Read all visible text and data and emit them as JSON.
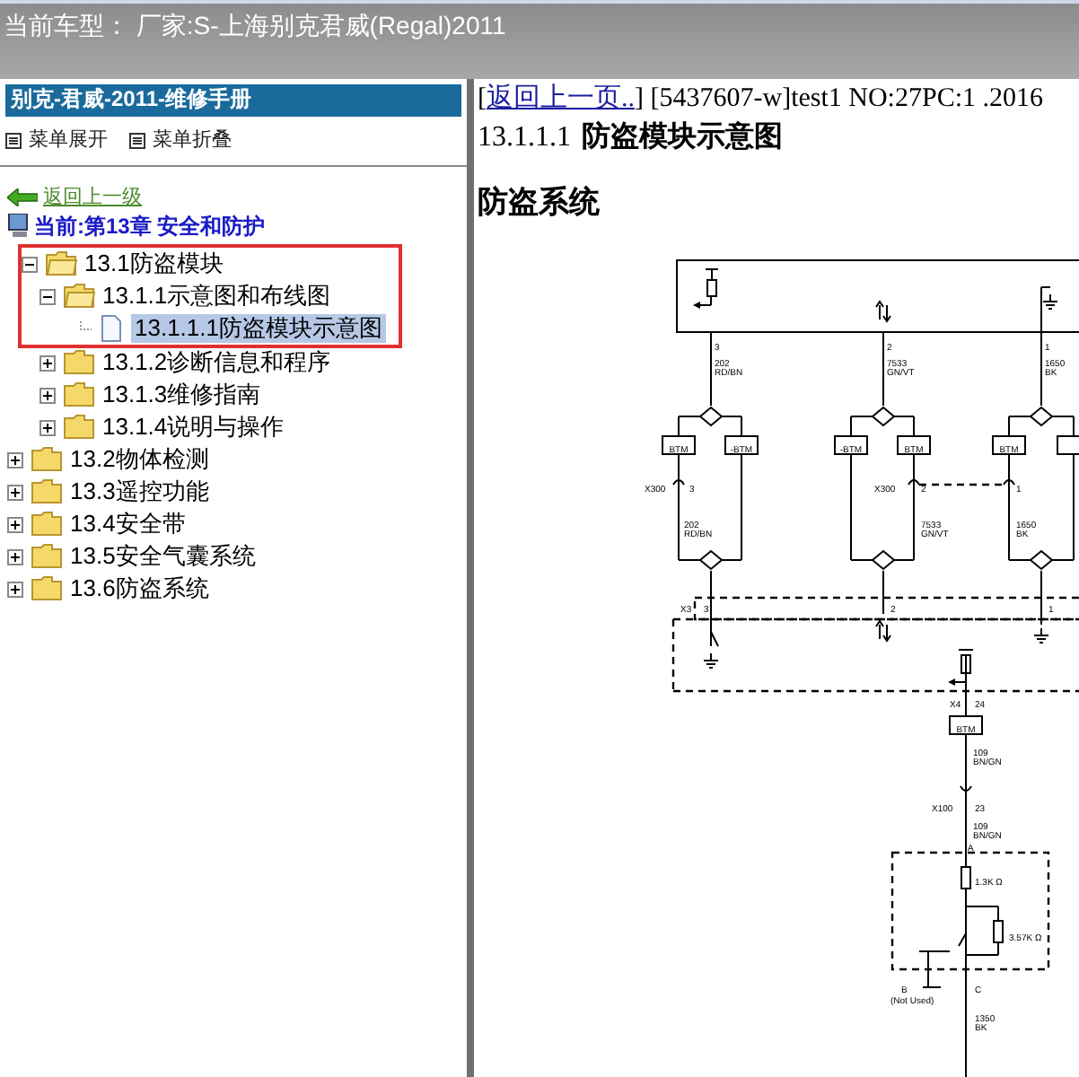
{
  "header": {
    "title": "当前车型： 厂家:S-上海别克君威(Regal)2011"
  },
  "sidebar": {
    "title": "别克-君威-2011-维修手册",
    "menu": [
      {
        "label": "菜单展开"
      },
      {
        "label": "菜单折叠"
      }
    ],
    "back_link": "返回上一级",
    "current": "当前:第13章 安全和防护",
    "tree": [
      {
        "label": "13.1防盗模块",
        "kind": "folder",
        "expanded": true,
        "selected": false,
        "framed": true,
        "children": [
          {
            "label": "13.1.1示意图和布线图",
            "kind": "folder",
            "expanded": true,
            "selected": false,
            "framed": true,
            "children": [
              {
                "label": "13.1.1.1防盗模块示意图",
                "kind": "page",
                "selected": true,
                "framed": true
              }
            ]
          },
          {
            "label": "13.1.2诊断信息和程序",
            "kind": "folder",
            "expanded": false,
            "selected": false,
            "framed": false
          },
          {
            "label": "13.1.3维修指南",
            "kind": "folder",
            "expanded": false,
            "selected": false,
            "framed": false
          },
          {
            "label": "13.1.4说明与操作",
            "kind": "folder",
            "expanded": false,
            "selected": false,
            "framed": false
          }
        ]
      },
      {
        "label": "13.2物体检测",
        "kind": "folder",
        "expanded": false,
        "selected": false,
        "framed": false
      },
      {
        "label": "13.3遥控功能",
        "kind": "folder",
        "expanded": false,
        "selected": false,
        "framed": false
      },
      {
        "label": "13.4安全带",
        "kind": "folder",
        "expanded": false,
        "selected": false,
        "framed": false
      },
      {
        "label": "13.5安全气囊系统",
        "kind": "folder",
        "expanded": false,
        "selected": false,
        "framed": false
      },
      {
        "label": "13.6防盗系统",
        "kind": "folder",
        "expanded": false,
        "selected": false,
        "framed": false
      }
    ]
  },
  "content": {
    "prefix": "[",
    "back_link": "返回上一页..",
    "info": "] [5437607-w]test1 NO:27PC:1 .2016",
    "number": "13.1.1.1",
    "title": "防盗模块示意图",
    "heading": "防盗系统",
    "diagram": {
      "labels": [
        "3",
        "202",
        "RD/BN",
        "2",
        "7533",
        "GN/VT",
        "1",
        "1650",
        "BK",
        "BTM",
        "-BTM",
        "-BTM",
        "BTM",
        "BTM",
        "X300",
        "3",
        "202",
        "RD/BN",
        "X300",
        "2",
        "7533",
        "GN/VT",
        "1",
        "1650",
        "BK",
        "X3",
        "3",
        "2",
        "1",
        "X4",
        "24",
        "BTM",
        "109",
        "BN/GN",
        "X100",
        "23",
        "109",
        "BN/GN",
        "A",
        "1.3K Ω",
        "3.57K Ω",
        "B",
        "(Not Used)",
        "C",
        "1350",
        "BK"
      ]
    }
  }
}
